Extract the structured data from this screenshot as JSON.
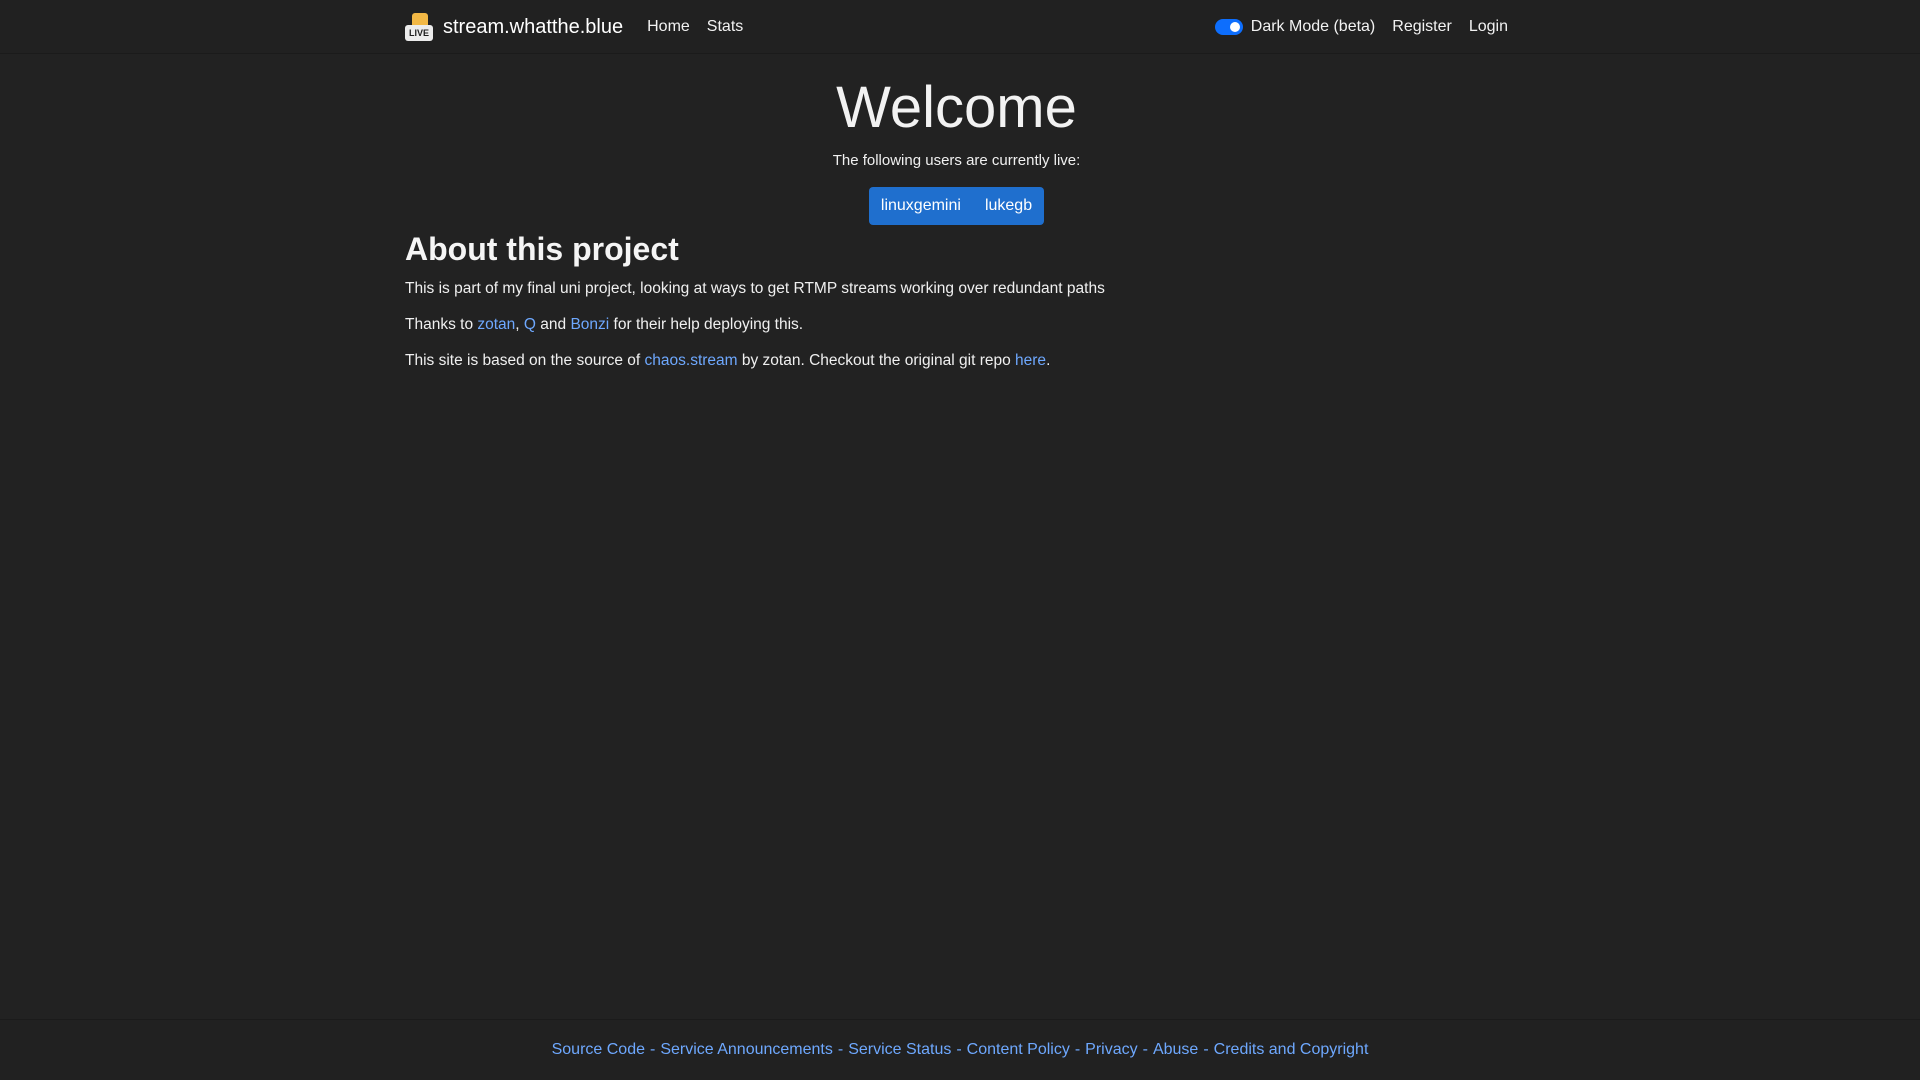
{
  "brand": {
    "name": "stream.whatthe.blue",
    "logo_icon": "live-logo-icon",
    "logo_text": "LIVE"
  },
  "nav": {
    "links": [
      "Home",
      "Stats"
    ],
    "dark_mode_label": "Dark Mode (beta)",
    "dark_mode_on": true,
    "register": "Register",
    "login": "Login"
  },
  "hero": {
    "title": "Welcome",
    "subtitle": "The following users are currently live:",
    "live_users": [
      "linuxgemini",
      "lukegb"
    ]
  },
  "about": {
    "title": "About this project",
    "line1": "This is part of my final uni project, looking at ways to get RTMP streams working over redundant paths",
    "thanks_prefix": "Thanks to ",
    "thanks_link1": "zotan",
    "thanks_comma": ", ",
    "thanks_link2": "Q",
    "thanks_and": " and ",
    "thanks_link3": "Bonzi",
    "thanks_suffix": " for their help deploying this.",
    "source_prefix": "This site is based on the source of ",
    "source_link": "chaos.stream",
    "source_mid": " by zotan. Checkout the original git repo ",
    "source_link2": "here",
    "source_suffix": "."
  },
  "footer": {
    "links": [
      "Source Code",
      "Service Announcements",
      "Service Status",
      "Content Policy",
      "Privacy",
      "Abuse",
      "Credits and Copyright"
    ],
    "separator": "-"
  },
  "colors": {
    "background": "#222222",
    "accent": "#1f6fce",
    "link": "#6ea8fe"
  }
}
